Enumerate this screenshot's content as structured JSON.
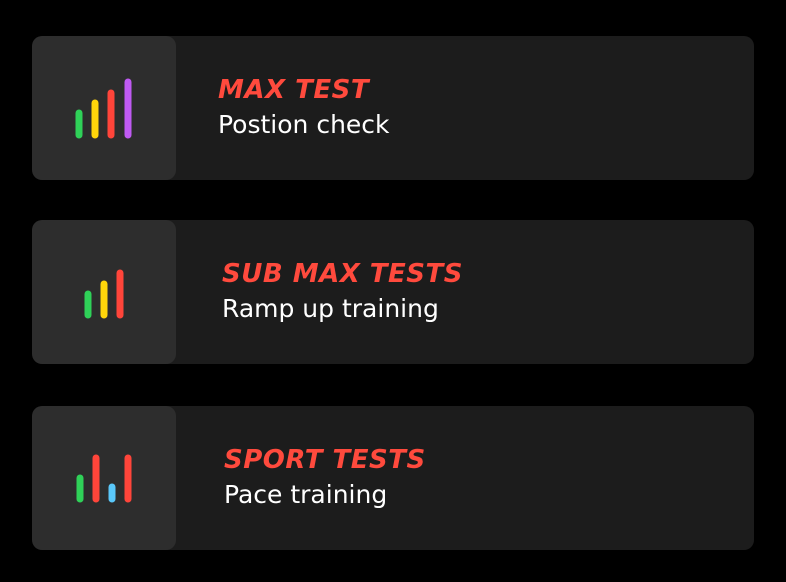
{
  "cards": [
    {
      "title": "MAX TEST",
      "subtitle": "Postion check",
      "icon": "bar-signal-icon-four-bars",
      "bar_colors": [
        "#2fd158",
        "#ffd60a",
        "#ff453a",
        "#bf5af2"
      ]
    },
    {
      "title": "SUB MAX TESTS",
      "subtitle": "Ramp up training",
      "icon": "bar-signal-icon-three-bars",
      "bar_colors": [
        "#2fd158",
        "#ffd60a",
        "#ff453a"
      ]
    },
    {
      "title": "SPORT TESTS",
      "subtitle": "Pace training",
      "icon": "bar-activity-icon",
      "bar_colors": [
        "#2fd158",
        "#ff453a",
        "#5ac8fa",
        "#ff453a"
      ]
    }
  ],
  "colors": {
    "background": "#000000",
    "card": "#1c1c1c",
    "icon_tile": "#2d2d2d",
    "title": "#ff4a3d",
    "subtitle": "#ffffff"
  }
}
